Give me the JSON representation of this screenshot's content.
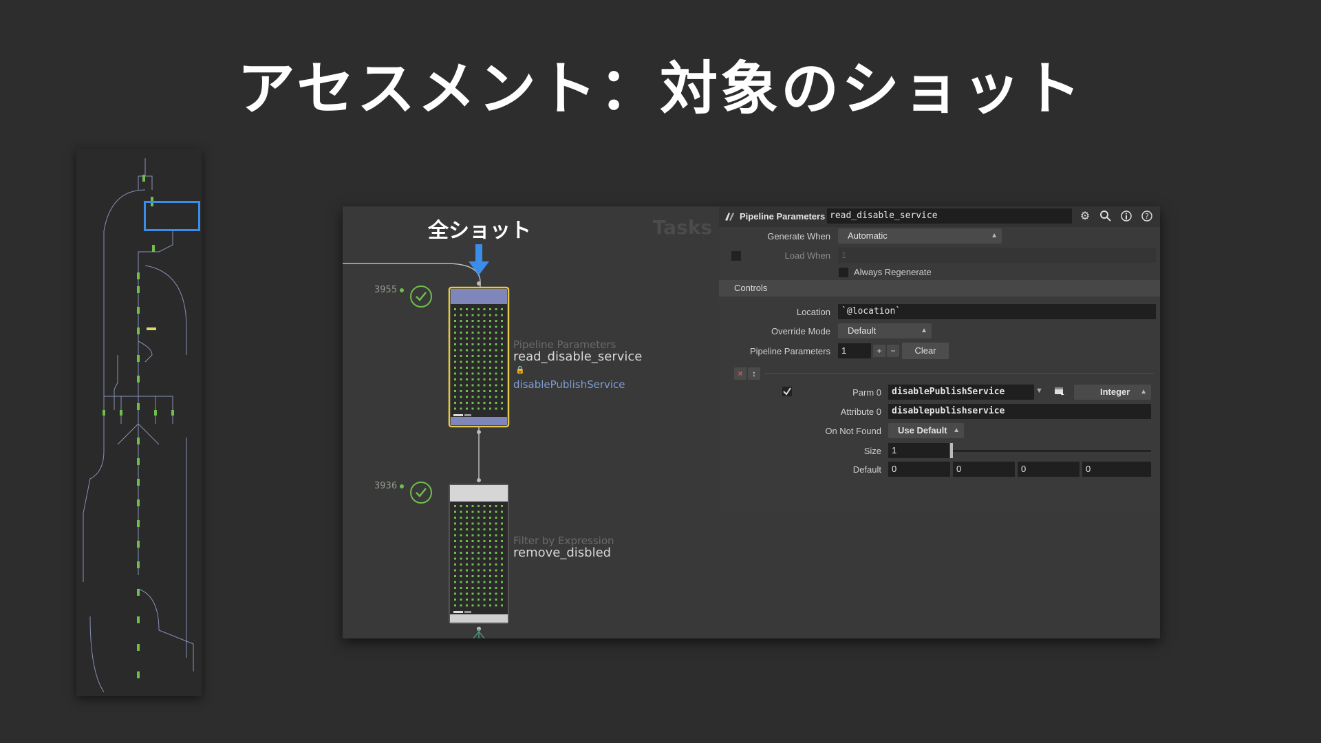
{
  "slide": {
    "title": "アセスメント：対象のショット",
    "callout": "全ショット"
  },
  "graph": {
    "tasks_label": "Tasks",
    "node1": {
      "count": "3955",
      "type": "Pipeline Parameters",
      "name": "read_disable_service",
      "attribute": "disablePublishService"
    },
    "node2": {
      "count": "3936",
      "type": "Filter by Expression",
      "name": "remove_disbled"
    }
  },
  "params": {
    "header_title": "Pipeline Parameters",
    "node_name": "read_disable_service",
    "icons": [
      "gear-icon",
      "search-icon",
      "info-icon",
      "help-icon"
    ],
    "generate_when": {
      "label": "Generate When",
      "value": "Automatic"
    },
    "load_when": {
      "label": "Load When",
      "value": "1"
    },
    "always_regenerate": {
      "label": "Always Regenerate"
    },
    "controls_section": "Controls",
    "location": {
      "label": "Location",
      "value": "`@location`"
    },
    "override_mode": {
      "label": "Override Mode",
      "value": "Default"
    },
    "pipeline_parameters": {
      "label": "Pipeline Parameters",
      "value": "1",
      "plus": "+",
      "minus": "−",
      "clear": "Clear"
    },
    "multi_remove": "×",
    "multi_insert": "↕",
    "parm0": {
      "label": "Parm 0",
      "value": "disablePublishService",
      "type": "Integer"
    },
    "attribute0": {
      "label": "Attribute 0",
      "value": "disablepublishservice"
    },
    "on_not_found": {
      "label": "On Not Found",
      "value": "Use Default"
    },
    "size": {
      "label": "Size",
      "value": "1"
    },
    "default": {
      "label": "Default",
      "values": [
        "0",
        "0",
        "0",
        "0"
      ]
    }
  },
  "colors": {
    "accent_blue": "#3a8eea",
    "selected_node_border": "#e6c84a",
    "node_header": "#7f86b9",
    "status_green": "#6fbf4a"
  }
}
